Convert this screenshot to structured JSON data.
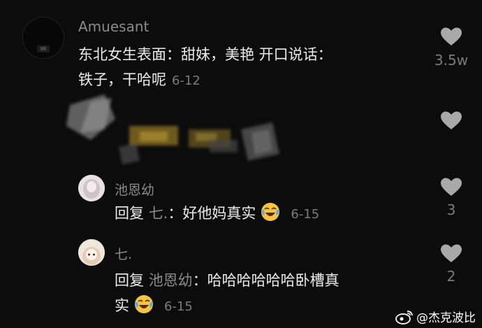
{
  "comments": [
    {
      "username": "Amuesant",
      "text": "东北女生表面：甜妹，美艳 开口说话：铁子，干哈呢",
      "text_line1": "东北女生表面：甜妹，美艳 开口说话：",
      "text_line2": "铁子，干哈呢",
      "date": "6-12",
      "likes": "3.5w"
    }
  ],
  "replies": [
    {
      "username": "池恩幼",
      "reply_prefix": "回复",
      "reply_to": "七.",
      "text": "：好他妈真实",
      "emoji": "crying-laughing-emoji",
      "date": "6-15",
      "likes": "3"
    },
    {
      "username": "七.",
      "reply_prefix": "回复",
      "reply_to": "池恩幼",
      "text_line1": "：哈哈哈哈哈哈卧槽真",
      "text_line2": "实",
      "emoji": "crying-laughing-emoji",
      "date": "6-15",
      "likes": "2"
    }
  ],
  "watermark": {
    "text": "@杰克波比",
    "icon": "weibo-icon"
  },
  "colors": {
    "background": "#0c0c0c",
    "text": "#ececec",
    "muted": "#8a8a8a",
    "heart": "#a9a9a9"
  }
}
